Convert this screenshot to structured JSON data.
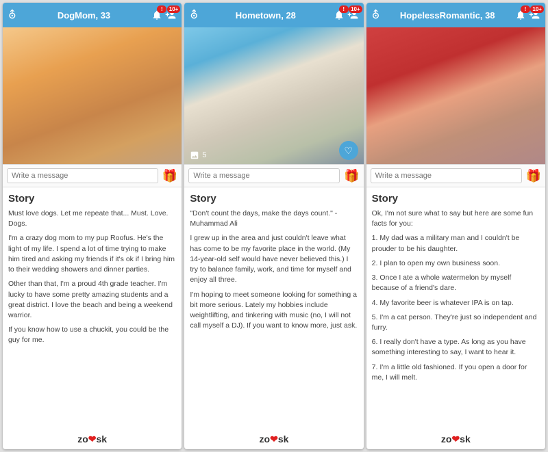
{
  "cards": [
    {
      "id": "card1",
      "name": "DogMom, 33",
      "photo_bg": "photo-1",
      "has_overlay": false,
      "message_placeholder": "Write a message",
      "story_title": "Story",
      "story_paragraphs": [
        "Must love dogs. Let me repeate that... Must. Love. Dogs.",
        "I'm a crazy dog mom to my pup Roofus. He's the light of my life. I spend a lot of time trying to make him tired and asking my friends if it's ok if I bring him to their wedding showers and dinner parties.",
        "Other than that, I'm a proud 4th grade teacher. I'm lucky to have some pretty amazing students and a great district. I love the beach and being a weekend warrior.",
        "If you know how to use a chuckit, you could be the guy for me."
      ]
    },
    {
      "id": "card2",
      "name": "Hometown, 28",
      "photo_bg": "photo-2",
      "has_overlay": true,
      "overlay_count": "5",
      "message_placeholder": "Write a message",
      "story_title": "Story",
      "story_paragraphs": [
        "\"Don't count the days, make the days count.\" -Muhammad Ali",
        "I grew up in the area and just couldn't leave what has come to be my favorite place in the world. (My 14-year-old self would have never believed this.) I try to balance family, work, and time for myself and enjoy all three.",
        "I'm hoping to meet someone looking for something a bit more serious. Lately my hobbies include weightlifting, and tinkering with music (no, I will not call myself a DJ). If you want to know more, just ask."
      ]
    },
    {
      "id": "card3",
      "name": "HopelessRomantic, 38",
      "photo_bg": "photo-3",
      "has_overlay": false,
      "message_placeholder": "Write a message",
      "story_title": "Story",
      "story_paragraphs": [
        "Ok, I'm not sure what to say but here are some fun facts for you:",
        "1. My dad was a military man and I couldn't be prouder to be his daughter.",
        "2. I plan to open my own business soon.",
        "3. Once I ate a whole watermelon by myself because of a friend's dare.",
        "4. My favorite beer is whatever IPA is on tap.",
        "5. I'm a cat person. They're just so independent and furry.",
        "6. I really don't have a type. As long as you have something interesting to say, I want to hear it.",
        "7. I'm a little old fashioned. If you open a door for me, I will melt."
      ]
    }
  ],
  "header": {
    "filter_icon": "⧩",
    "badge_1": "!",
    "badge_2": "10+"
  },
  "zoosk": {
    "text_before": "zo",
    "heart": "❤",
    "text_after": "sk"
  }
}
